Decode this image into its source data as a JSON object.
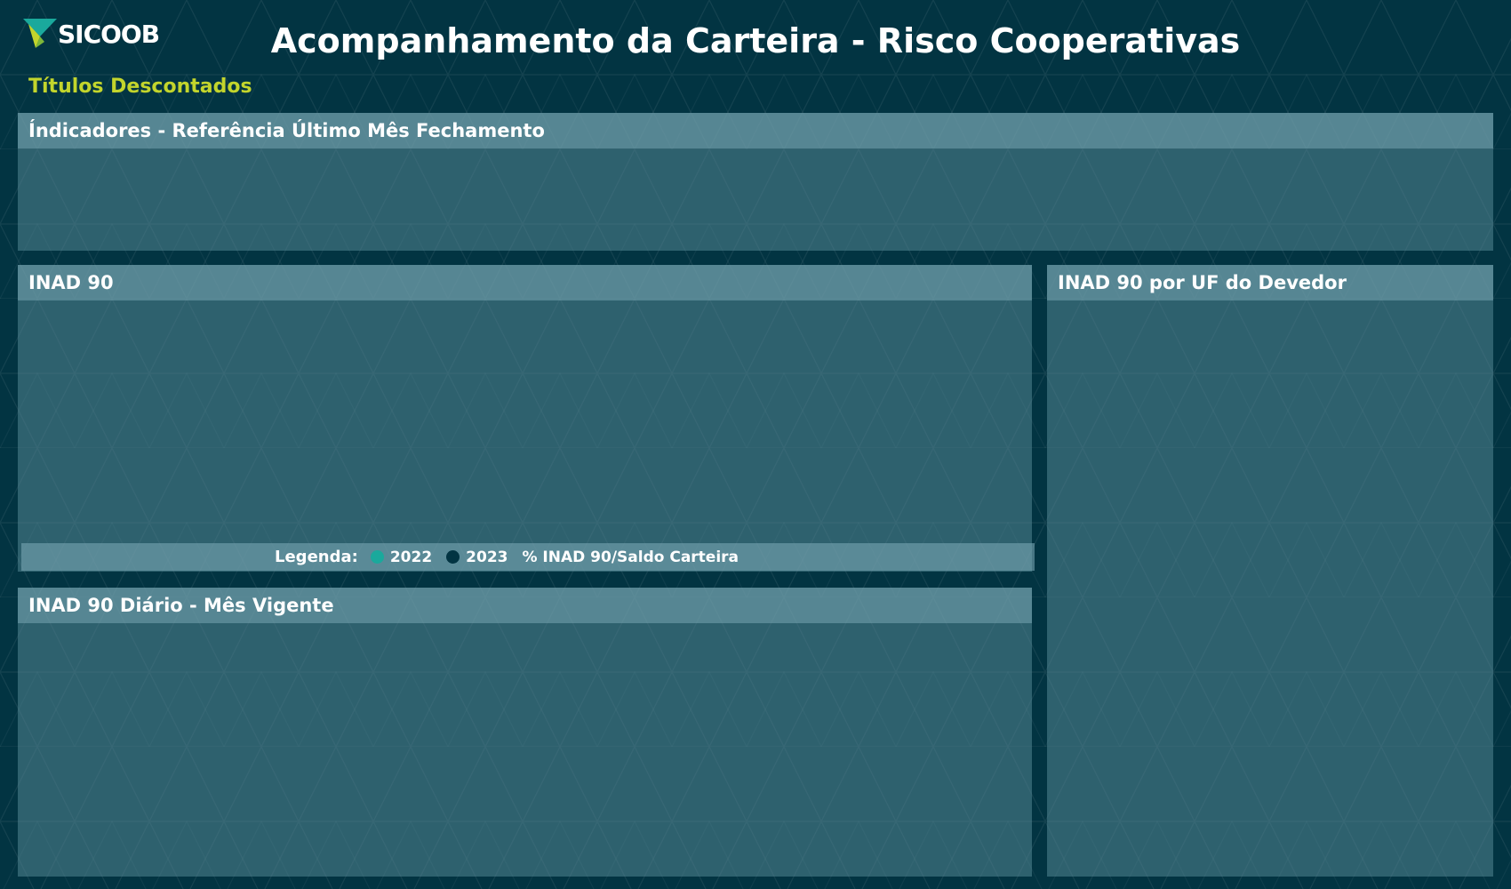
{
  "brand": {
    "name": "SICOOB",
    "logo_icon": "sicoob-logo-icon"
  },
  "page": {
    "title": "Acompanhamento da Carteira - Risco Cooperativas",
    "subtitle": "Títulos Descontados"
  },
  "colors": {
    "background": "#023442",
    "subtitle": "#c3d52c",
    "legend_2022": "#1aa99c",
    "legend_2023": "#023442"
  },
  "panels": {
    "indicadores": {
      "title": "Índicadores - Referência Último Mês Fechamento"
    },
    "inad90": {
      "title": "INAD 90"
    },
    "uf": {
      "title": "INAD 90 por UF do Devedor"
    },
    "diario": {
      "title": "INAD 90 Diário - Mês Vigente"
    }
  },
  "legend": {
    "title": "Legenda:",
    "items": [
      {
        "label": "2022",
        "color": "#1aa99c"
      },
      {
        "label": "2023",
        "color": "#023442"
      },
      {
        "label": "% INAD 90/Saldo Carteira",
        "color": ""
      }
    ]
  }
}
